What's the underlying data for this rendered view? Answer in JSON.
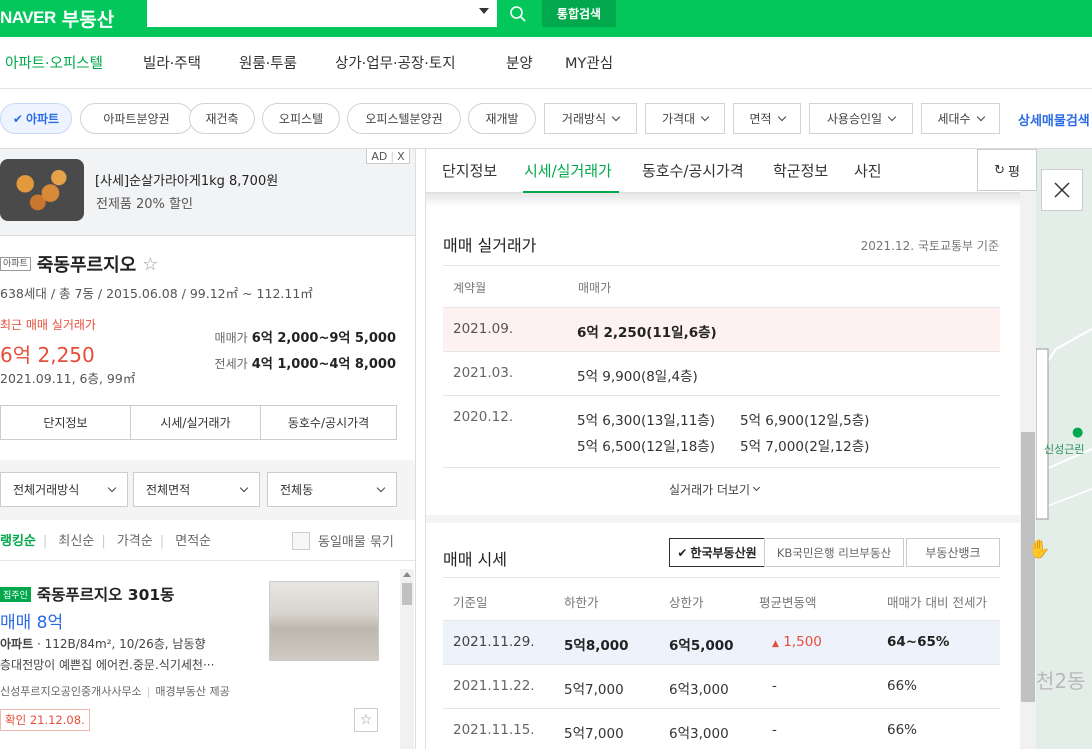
{
  "brand": {
    "logo": "NAVER",
    "service": "부동산"
  },
  "header": {
    "unified_search": "통합검색"
  },
  "nav": [
    {
      "label": "아파트·오피스텔",
      "active": true
    },
    {
      "label": "빌라·주택"
    },
    {
      "label": "원룸·투룸"
    },
    {
      "label": "상가·업무·공장·토지"
    },
    {
      "label": "분양"
    },
    {
      "label": "MY관심"
    }
  ],
  "filters": {
    "chips": [
      "아파트",
      "아파트분양권",
      "재건축",
      "오피스텔",
      "오피스텔분양권",
      "재개발"
    ],
    "dropdowns": [
      "거래방식",
      "가격대",
      "면적",
      "사용승인일",
      "세대수"
    ],
    "detail_search": "상세매물검색"
  },
  "ad": {
    "title": "[사세]순살가라아게1kg 8,700원",
    "subtitle": "전제품 20% 할인",
    "tag": "AD",
    "close": "X"
  },
  "complex": {
    "type_tag": "아파트",
    "name": "죽동푸르지오",
    "star": "☆",
    "info": "638세대 / 총 7동 / 2015.06.08 / 99.12㎡ ~ 112.11㎡",
    "recent_label": "최근 매매 실거래가",
    "recent_price": "6억 2,250",
    "recent_detail": "2021.09.11, 6층, 99㎡",
    "sale_label": "매매가",
    "sale_range": "6억 2,000~9억 5,000",
    "lease_label": "전세가",
    "lease_range": "4억 1,000~4억 8,000",
    "buttons": [
      "단지정보",
      "시세/실거래가",
      "동호수/공시가격"
    ]
  },
  "list_filters": {
    "dropdowns": [
      "전체거래방식",
      "전체면적",
      "전체동"
    ],
    "sort": [
      "랭킹순",
      "최신순",
      "가격순",
      "면적순"
    ],
    "group_label": "동일매물 묶기"
  },
  "listing": {
    "badge": "집주인",
    "title": "죽동푸르지오 301동",
    "price": "매매 8억",
    "type": "아파트",
    "spec": "112B/84m², 10/26층, 남동향",
    "desc": "층대전망이 예쁜집 에어컨.중문.식기세천···",
    "agent": "신성푸르지오공인중개사사무소",
    "provider": "매경부동산 제공",
    "confirm": "확인 21.12.08.",
    "star": "☆"
  },
  "detail": {
    "tabs": [
      "단지정보",
      "시세/실거래가",
      "동호수/공시가격",
      "학군정보",
      "사진"
    ],
    "active_tab": 1,
    "refresh": "평",
    "trade": {
      "title": "매매 실거래가",
      "source": "2021.12. 국토교통부 기준",
      "headers": [
        "계약월",
        "매매가"
      ],
      "rows": [
        {
          "month": "2021.09.",
          "prices": [
            "6억 2,250(11일,6층)"
          ],
          "highlight": true
        },
        {
          "month": "2021.03.",
          "prices": [
            "5억 9,900(8일,4층)"
          ]
        },
        {
          "month": "2020.12.",
          "prices": [
            "5억 6,300(13일,11층)",
            "5억 6,900(12일,5층)",
            "5억 6,500(12일,18층)",
            "5억 7,000(2일,12층)"
          ]
        }
      ],
      "more": "실거래가 더보기"
    },
    "market": {
      "title": "매매 시세",
      "sources": [
        "한국부동산원",
        "KB국민은행 리브부동산",
        "부동산뱅크"
      ],
      "headers": [
        "기준일",
        "하한가",
        "상한가",
        "평균변동액",
        "매매가 대비 전세가"
      ],
      "rows": [
        {
          "date": "2021.11.29.",
          "low": "5억8,000",
          "high": "6억5,000",
          "change": "1,500",
          "ratio": "64~65%"
        },
        {
          "date": "2021.11.22.",
          "low": "5억7,000",
          "high": "6억3,000",
          "change": "-",
          "ratio": "66%"
        },
        {
          "date": "2021.11.15.",
          "low": "5억7,000",
          "high": "6억3,000",
          "change": "-",
          "ratio": "66%"
        }
      ]
    }
  },
  "map": {
    "poi": "신성근린",
    "area": "천2동"
  },
  "colors": {
    "brand": "#03c75a",
    "accent_blue": "#2a6be6",
    "price_red": "#e64e3c"
  }
}
